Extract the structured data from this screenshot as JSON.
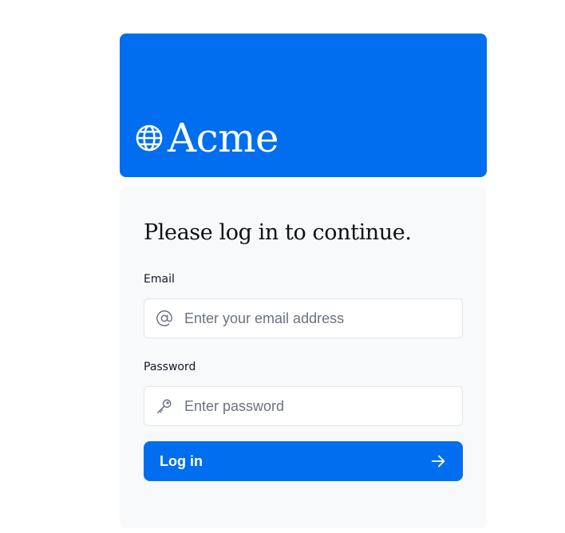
{
  "brand": {
    "name": "Acme",
    "logo_icon": "globe-icon",
    "banner_color": "#006eef"
  },
  "login_form": {
    "heading": "Please log in to continue.",
    "email": {
      "label": "Email",
      "placeholder": "Enter your email address",
      "value": "",
      "icon": "at-sign-icon"
    },
    "password": {
      "label": "Password",
      "placeholder": "Enter password",
      "value": "",
      "icon": "key-icon"
    },
    "submit": {
      "label": "Log in",
      "icon": "arrow-right-icon",
      "color": "#006eef"
    }
  }
}
